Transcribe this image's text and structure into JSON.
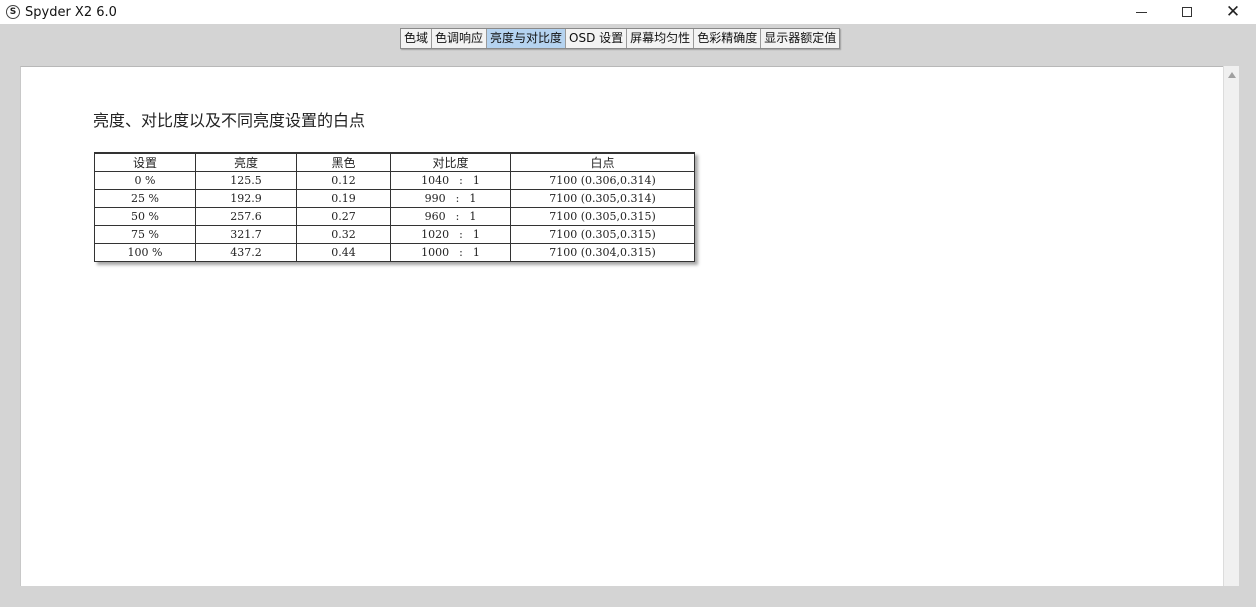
{
  "window": {
    "icon_letter": "S",
    "title": "Spyder X2 6.0",
    "minimize": "",
    "maximize": "",
    "close": "✕"
  },
  "tabs": [
    {
      "label": "色域",
      "active": false
    },
    {
      "label": "色调响应",
      "active": false
    },
    {
      "label": "亮度与对比度",
      "active": true
    },
    {
      "label": "OSD 设置",
      "active": false
    },
    {
      "label": "屏幕均匀性",
      "active": false
    },
    {
      "label": "色彩精确度",
      "active": false
    },
    {
      "label": "显示器额定值",
      "active": false
    }
  ],
  "zoom": {
    "zoom_in_icon": "zoom-in-icon",
    "zoom_out_icon": "zoom-out-icon",
    "zoom_fit_icon": "zoom-fit-icon"
  },
  "document": {
    "title": "亮度、对比度以及不同亮度设置的白点",
    "table": {
      "headers": [
        "设置",
        "亮度",
        "黑色",
        "对比度",
        "白点"
      ],
      "rows": [
        {
          "setting": "0 %",
          "brightness": "125.5",
          "black": "0.12",
          "contrast_a": "1040",
          "contrast_sep": ":",
          "contrast_b": "1",
          "white_point": "7100 (0.306,0.314)"
        },
        {
          "setting": "25 %",
          "brightness": "192.9",
          "black": "0.19",
          "contrast_a": "990",
          "contrast_sep": ":",
          "contrast_b": "1",
          "white_point": "7100 (0.305,0.314)"
        },
        {
          "setting": "50 %",
          "brightness": "257.6",
          "black": "0.27",
          "contrast_a": "960",
          "contrast_sep": ":",
          "contrast_b": "1",
          "white_point": "7100 (0.305,0.315)"
        },
        {
          "setting": "75 %",
          "brightness": "321.7",
          "black": "0.32",
          "contrast_a": "1020",
          "contrast_sep": ":",
          "contrast_b": "1",
          "white_point": "7100 (0.305,0.315)"
        },
        {
          "setting": "100 %",
          "brightness": "437.2",
          "black": "0.44",
          "contrast_a": "1000",
          "contrast_sep": ":",
          "contrast_b": "1",
          "white_point": "7100 (0.304,0.315)"
        }
      ]
    }
  },
  "colors": {
    "active_tab": "#b5d3f0",
    "app_background": "#d4d4d4",
    "document_background": "#ffffff"
  }
}
